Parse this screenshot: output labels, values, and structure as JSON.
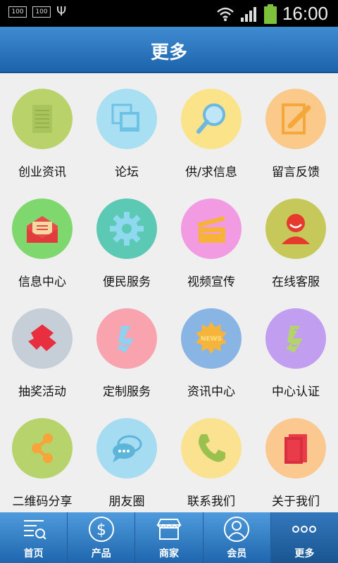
{
  "status_bar": {
    "time": "16:00",
    "icon_small_1": "100",
    "icon_small_2": "100"
  },
  "header": {
    "title": "更多"
  },
  "grid": [
    {
      "label": "创业资讯",
      "icon": "document-icon",
      "color": "#b9d36a"
    },
    {
      "label": "论坛",
      "icon": "forum-icon",
      "color": "#a8dff2"
    },
    {
      "label": "供/求信息",
      "icon": "magnifier-icon",
      "color": "#fbe38a"
    },
    {
      "label": "留言反馈",
      "icon": "edit-icon",
      "color": "#fbc98a"
    },
    {
      "label": "信息中心",
      "icon": "mail-icon",
      "color": "#7fd86d"
    },
    {
      "label": "便民服务",
      "icon": "gear-icon",
      "color": "#5cc9b5"
    },
    {
      "label": "视频宣传",
      "icon": "clapboard-icon",
      "color": "#f29be2"
    },
    {
      "label": "在线客服",
      "icon": "person-icon",
      "color": "#c7c85a"
    },
    {
      "label": "抽奖活动",
      "icon": "puzzle-icon",
      "color": "#c6ced7"
    },
    {
      "label": "定制服务",
      "icon": "custom-service-icon",
      "color": "#f8a3ae"
    },
    {
      "label": "资讯中心",
      "icon": "news-badge-icon",
      "color": "#89b5e4"
    },
    {
      "label": "中心认证",
      "icon": "certify-icon",
      "color": "#c29ef0"
    },
    {
      "label": "二维码分享",
      "icon": "share-icon",
      "color": "#b6d36c"
    },
    {
      "label": "朋友圈",
      "icon": "chat-bubble-icon",
      "color": "#a6dcf2"
    },
    {
      "label": "联系我们",
      "icon": "phone-icon",
      "color": "#fbe291"
    },
    {
      "label": "关于我们",
      "icon": "book-icon",
      "color": "#fbc98f"
    }
  ],
  "tabs": [
    {
      "label": "首页",
      "icon": "home-list-icon"
    },
    {
      "label": "产品",
      "icon": "dollar-icon"
    },
    {
      "label": "商家",
      "icon": "store-icon"
    },
    {
      "label": "会员",
      "icon": "member-icon"
    },
    {
      "label": "更多",
      "icon": "more-dots-icon",
      "active": true
    }
  ]
}
